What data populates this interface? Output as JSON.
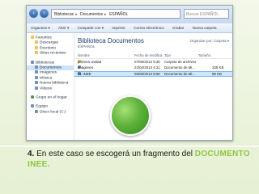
{
  "window": {
    "address_parts": [
      "Bibliotecas",
      "Documentos",
      "ESPAÑOL"
    ],
    "search_placeholder": "Buscar ESPAÑOL",
    "toolbar": [
      "Organizar ▾",
      "Abrir ▾",
      "Compartir con ▾",
      "Imprimir",
      "Correo electrónico",
      "Grabar",
      "Nueva carpeta"
    ]
  },
  "navpane": {
    "favorites": {
      "title": "Favoritos",
      "items": [
        "Descargas",
        "Escritorio",
        "Sitios recientes"
      ]
    },
    "libraries": {
      "title": "Bibliotecas",
      "items": [
        "Documentos",
        "Imágenes",
        "Música",
        "Nueva biblioteca",
        "Vídeos"
      ]
    },
    "homegroup": "Grupo en el hogar",
    "computer": {
      "title": "Equipo",
      "items": [
        "Disco local (C:)"
      ]
    }
  },
  "content": {
    "title": "Biblioteca Documentos",
    "subtitle": "ESPAÑOL",
    "organize_label": "Organizar por: Carpeta ▾",
    "columns": [
      "Nombre",
      "Fecha de modifica...",
      "Tipo",
      "Tamaño"
    ],
    "files": [
      {
        "name": "primera unidad",
        "date": "07/05/2013 6:30",
        "type": "Carpeta de archivos",
        "size": ""
      },
      {
        "name": "imagenes",
        "date": "22/04/2013 4:21",
        "type": "Documento de Mi...",
        "size": "326 KB"
      },
      {
        "name": "EL INEE",
        "date": "05/06/2013 8:06",
        "type": "Documento de Mi...",
        "size": "96 KB"
      }
    ]
  },
  "caption": {
    "number": "4.",
    "text": " En este caso se escogerá un fragmento del ",
    "highlight": "DOCUMENTO INEE."
  },
  "colors": {
    "accent_green": "#8dc63f",
    "selection_blue": "#cde6fa"
  }
}
